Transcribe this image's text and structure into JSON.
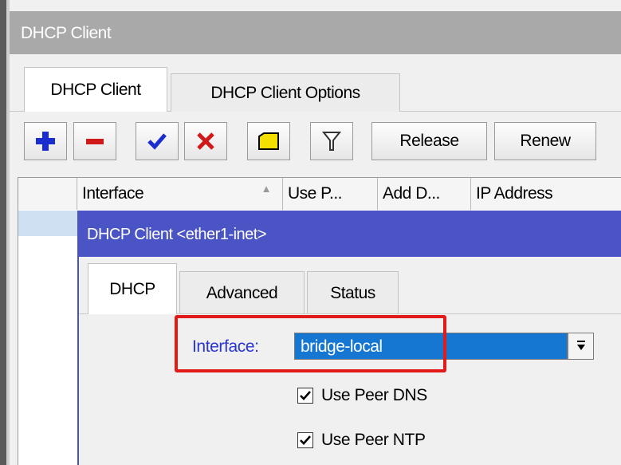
{
  "window": {
    "title": "DHCP Client"
  },
  "tabs": [
    {
      "label": "DHCP Client",
      "active": true
    },
    {
      "label": "DHCP Client Options",
      "active": false
    }
  ],
  "toolbar": {
    "add_icon": "plus-icon",
    "remove_icon": "minus-icon",
    "enable_icon": "check-icon",
    "disable_icon": "x-icon",
    "comment_icon": "note-icon",
    "filter_icon": "filter-icon",
    "release_label": "Release",
    "renew_label": "Renew"
  },
  "table": {
    "columns": [
      "Interface",
      "Use P...",
      "Add D...",
      "IP Address"
    ]
  },
  "dialog": {
    "title": "DHCP Client <ether1-inet>",
    "tabs": [
      {
        "label": "DHCP",
        "active": true
      },
      {
        "label": "Advanced",
        "active": false
      },
      {
        "label": "Status",
        "active": false
      }
    ],
    "interface_label": "Interface:",
    "interface_value": "bridge-local",
    "use_peer_dns_label": "Use Peer DNS",
    "use_peer_dns_checked": true,
    "use_peer_ntp_label": "Use Peer NTP",
    "use_peer_ntp_checked": true
  },
  "colors": {
    "titlebar": "#a9a9a9",
    "dialog_title": "#4a54c4",
    "selection": "#1677d2",
    "highlight": "#e31a1a",
    "field_label": "#2a35d0"
  }
}
